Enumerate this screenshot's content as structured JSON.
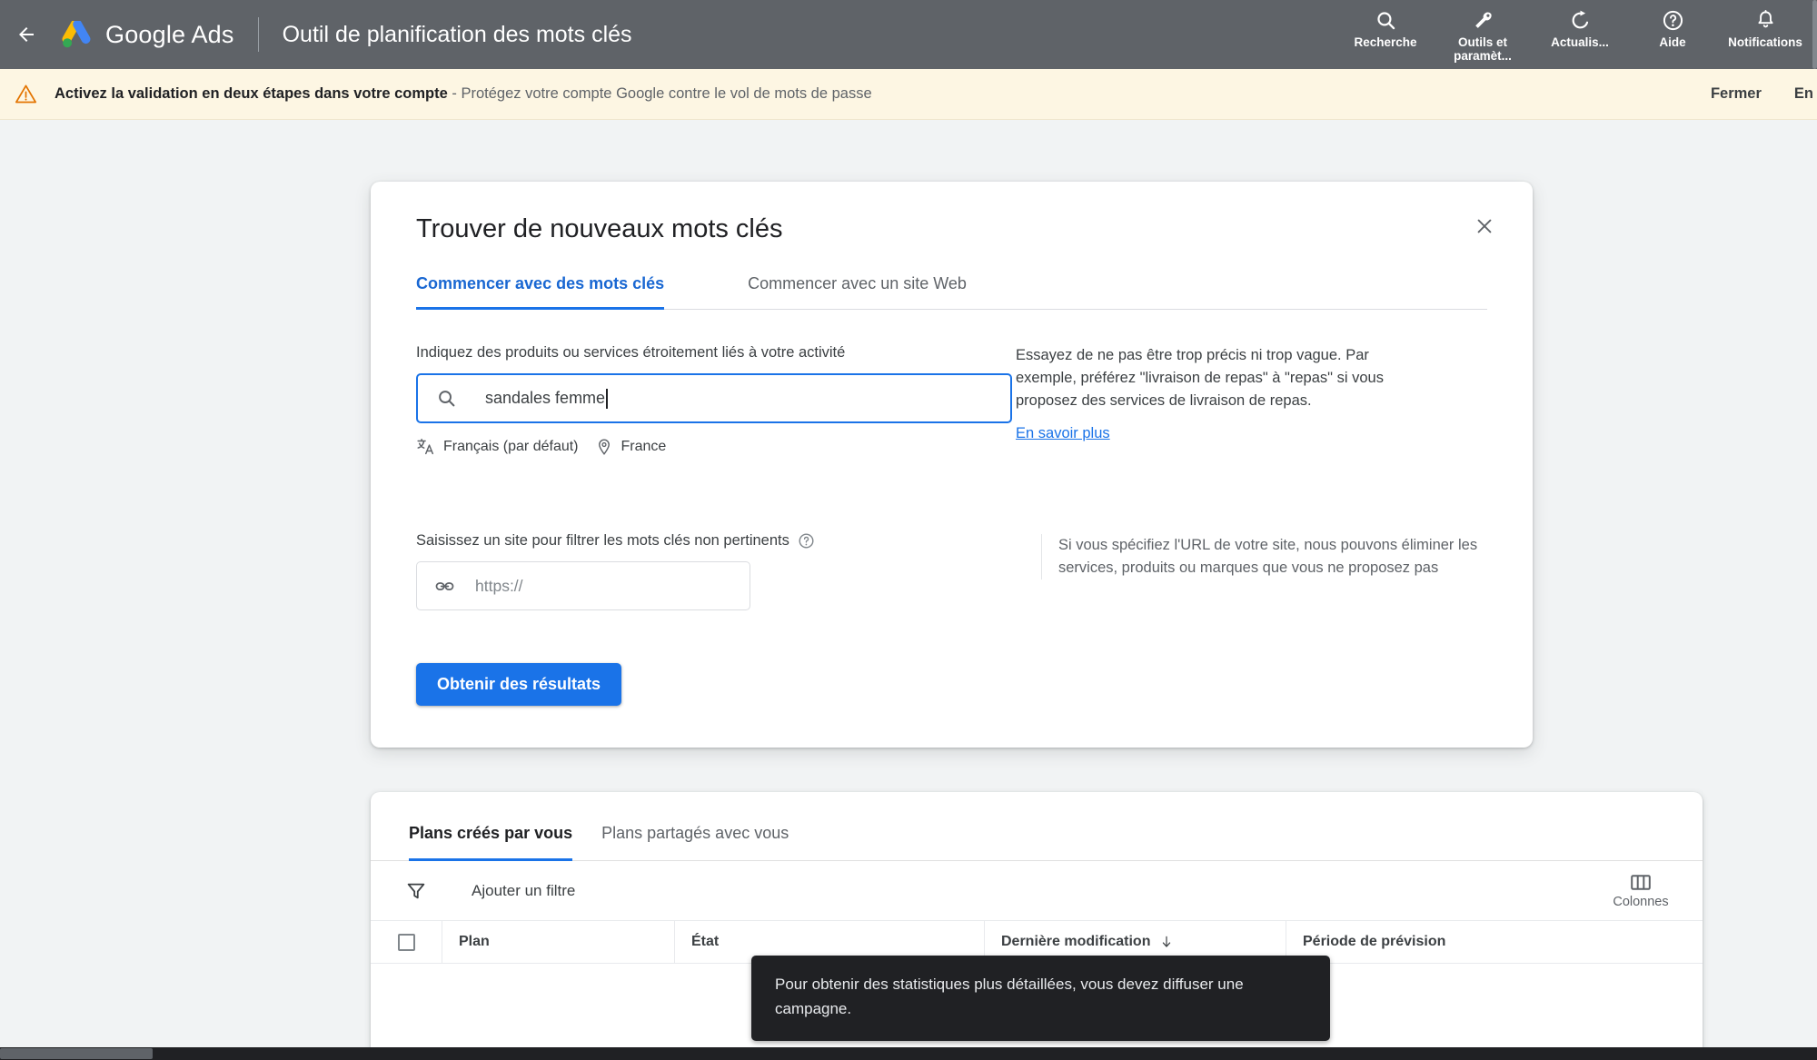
{
  "topbar": {
    "back_icon": "arrow-left-icon",
    "logo_icon": "google-ads-logo",
    "brand": "Google Ads",
    "page_title": "Outil de planification des mots clés",
    "actions": [
      {
        "icon": "search-icon",
        "label": "Recherche"
      },
      {
        "icon": "wrench-icon",
        "label": "Outils et paramèt..."
      },
      {
        "icon": "refresh-icon",
        "label": "Actualis..."
      },
      {
        "icon": "help-circle-icon",
        "label": "Aide"
      },
      {
        "icon": "bell-icon",
        "label": "Notifications"
      }
    ],
    "bg_color": "#5f6368"
  },
  "notice": {
    "icon": "warning-triangle-icon",
    "headline": "Activez la validation en deux étapes dans votre compte",
    "separator": " - ",
    "detail": "Protégez votre compte Google contre le vol de mots de passe",
    "dismiss_label": "Fermer",
    "secondary_label": "En",
    "bg_color": "#fdf6e3",
    "icon_color": "#e37400"
  },
  "dialog": {
    "title": "Trouver de nouveaux mots clés",
    "close_icon": "close-icon",
    "tabs": [
      {
        "label": "Commencer avec des mots clés",
        "active": true
      },
      {
        "label": "Commencer avec un site Web",
        "active": false
      }
    ],
    "keyword_field": {
      "label": "Indiquez des produits ou services étroitement liés à votre activité",
      "icon": "search-icon",
      "value": "sandales femme",
      "placeholder": "",
      "focus_color": "#1a73e8"
    },
    "meta": [
      {
        "icon": "translate-icon",
        "label": "Français (par défaut)"
      },
      {
        "icon": "location-pin-icon",
        "label": "France"
      }
    ],
    "keyword_hint": "Essayez de ne pas être trop précis ni trop vague. Par exemple, préférez \"livraison de repas\" à \"repas\" si vous proposez des services de livraison de repas.",
    "keyword_hint_link": "En savoir plus",
    "site_field": {
      "label": "Saisissez un site pour filtrer les mots clés non pertinents",
      "help_icon": "help-circle-icon",
      "icon": "link-icon",
      "value": "",
      "placeholder": "https://"
    },
    "site_note": "Si vous spécifiez l'URL de votre site, nous pouvons éliminer les services, produits ou marques que vous ne proposez pas",
    "submit_label": "Obtenir des résultats",
    "submit_color": "#1a73e8"
  },
  "plans": {
    "tabs": [
      {
        "label": "Plans créés par vous",
        "active": true
      },
      {
        "label": "Plans partagés avec vous",
        "active": false
      }
    ],
    "filter": {
      "icon": "filter-funnel-icon",
      "label": "Ajouter un filtre"
    },
    "columns_button": {
      "icon": "columns-icon",
      "label": "Colonnes"
    },
    "table": {
      "select_all_checkbox": "unchecked",
      "headers": [
        {
          "label": "Plan",
          "sort": ""
        },
        {
          "label": "État",
          "sort": ""
        },
        {
          "label": "Dernière modification",
          "sort": "descending-arrow-icon"
        },
        {
          "label": "Période de prévision",
          "sort": ""
        }
      ],
      "rows": []
    }
  },
  "tooltip": {
    "text": "Pour obtenir des statistiques plus détaillées, vous devez diffuser une campagne.",
    "bg_color": "#202124"
  },
  "scrollbars": {
    "horizontal_visible": true,
    "vertical_visible": true
  }
}
